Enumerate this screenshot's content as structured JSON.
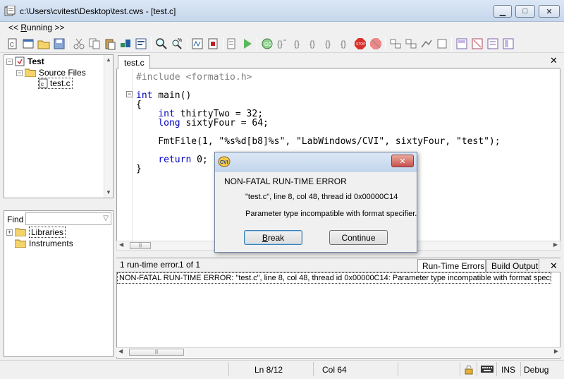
{
  "window": {
    "title": "c:\\Users\\cvitest\\Desktop\\test.cws - [test.c]",
    "controls": {
      "minimize": "▁",
      "maximize": "□",
      "close": "✕"
    }
  },
  "menu": {
    "running": "<< Running >>"
  },
  "toolbar": {
    "icons": [
      "new-file-icon",
      "open-file-icon",
      "open-folder-icon",
      "save-icon",
      "cut-icon",
      "copy-icon",
      "paste-icon",
      "build-icon",
      "run-icon",
      "find-icon",
      "find-next-icon",
      "breakpoint-icon",
      "stop-icon",
      "step-icon",
      "go-icon",
      "step-into-icon",
      "step-over-icon",
      "step-out-icon",
      "run-to-cursor-icon",
      "terminate-icon",
      "stop-sign-icon",
      "watch-icon",
      "variables-icon",
      "memory-icon",
      "callstack-icon",
      "tile-h-icon",
      "tile-v-icon",
      "cascade-icon"
    ]
  },
  "project_tree": {
    "root": "Test",
    "folder": "Source Files",
    "file": "test.c"
  },
  "find": {
    "label": "Find",
    "placeholder": "",
    "items": [
      "Libraries",
      "Instruments"
    ]
  },
  "editor": {
    "tab": "test.c",
    "close": "✕",
    "lines": [
      "#include <formatio.h>",
      "int main()",
      "{",
      "    int thirtyTwo = 32;",
      "    long sixtyFour = 64;",
      "    FmtFile(1, \"%s%d[b8]%s\", \"LabWindows/CVI\", sixtyFour, \"test\");",
      "    return 0;",
      "}"
    ]
  },
  "errors_panel": {
    "count": "1 run-time error.",
    "position": "1 of 1",
    "tabs": [
      "Run-Time Errors",
      "Build Output"
    ],
    "close": "✕",
    "rows": [
      "NON-FATAL RUN-TIME ERROR:   \"test.c\", line 8, col 48, thread id 0x00000C14:   Parameter type incompatible with format specifier."
    ]
  },
  "statusbar": {
    "line": "Ln 8/12",
    "col": "Col 64",
    "ins": "INS",
    "mode": "Debug"
  },
  "dialog": {
    "heading": "NON-FATAL RUN-TIME ERROR",
    "location": "\"test.c\", line 8, col 48, thread id 0x00000C14",
    "message": "Parameter type incompatible with format specifier.",
    "break_label": "Break",
    "continue_label": "Continue",
    "close": "✕"
  },
  "colors": {
    "keyword": "#0000c0",
    "preprocessor": "#808080",
    "title_bar": "#c6d7ec"
  }
}
